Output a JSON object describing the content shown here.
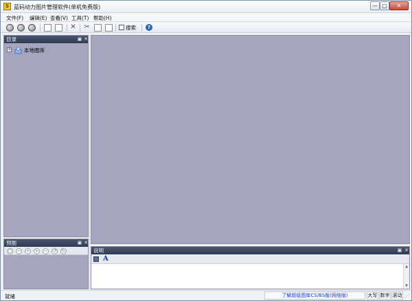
{
  "window": {
    "title": "蓝码动力图片管理软件(单机免费版)",
    "controls": {
      "minimize": "—",
      "maximize": "□",
      "close": "✕"
    }
  },
  "menu": {
    "items": [
      {
        "label": "文件(F)"
      },
      {
        "label": "编辑(E)"
      },
      {
        "label": "查看(V)"
      },
      {
        "label": "工具(T)"
      },
      {
        "label": "帮助(H)"
      }
    ]
  },
  "toolbar": {
    "search_label": "搜索",
    "help_label": "?"
  },
  "panels": {
    "directory": {
      "title": "目录",
      "tree_root": "本地图库"
    },
    "preview": {
      "title": "预图"
    },
    "description": {
      "title": "说明"
    }
  },
  "status": {
    "ready": "就绪",
    "link_text": "了解超级图库CS/BS版(网络版)",
    "indicators": [
      "大写",
      "数字",
      "滚动"
    ]
  },
  "colors": {
    "pane_bg": "#a5a5bf",
    "header_dark": "#2f3a52",
    "link_blue": "#1a3fd1"
  },
  "icons": {
    "pin": "pin-icon",
    "close": "close-icon",
    "search": "search-icon",
    "help": "help-icon",
    "save": "save-icon",
    "font": "font-icon"
  }
}
